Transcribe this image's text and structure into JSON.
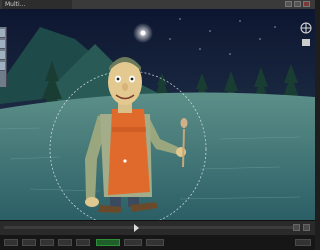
{
  "window": {
    "title": "Multi..."
  },
  "toolbar": {
    "tools": [
      "select-tool",
      "move-tool",
      "rotate-tool",
      "scale-tool"
    ]
  },
  "viewport": {
    "camera_widgets": [
      "axis-gizmo-icon",
      "view-icon"
    ]
  },
  "timeline": {
    "controls": [
      "play-button",
      "stop-button",
      "loop-button"
    ]
  },
  "colors": {
    "accent": "#e06a2c",
    "sky": "#0d1a33",
    "ground": "#2f6f70"
  }
}
